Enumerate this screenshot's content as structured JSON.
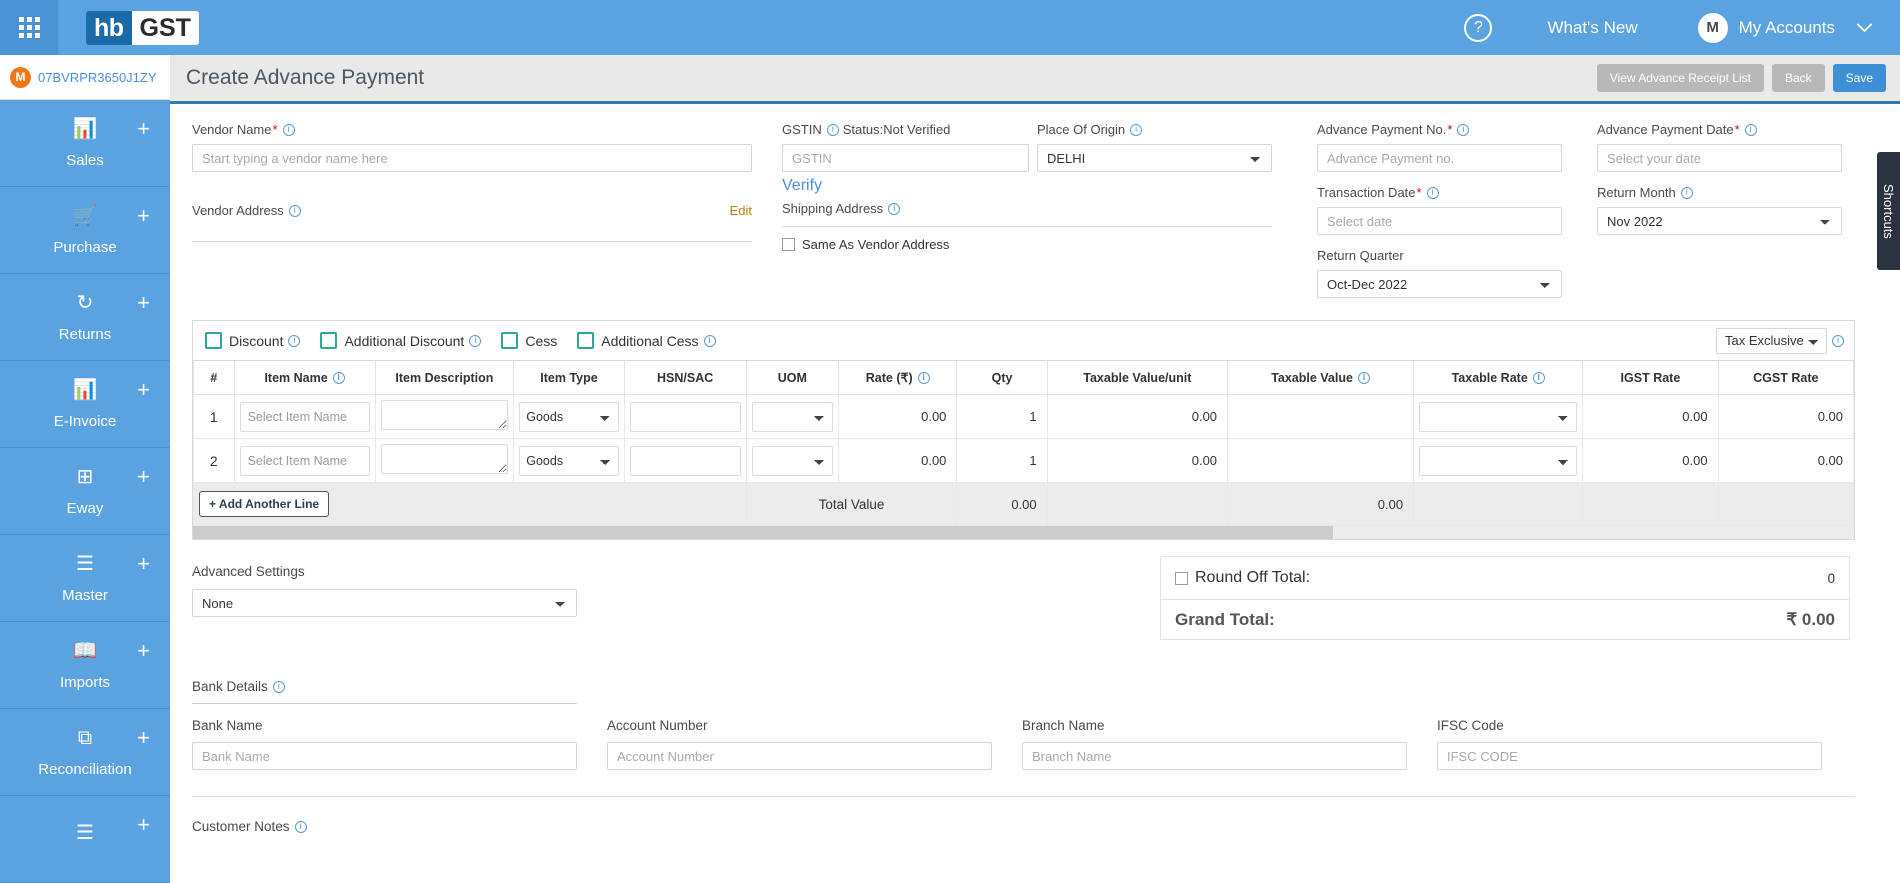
{
  "topbar": {
    "grid_icon": "apps-grid-icon",
    "logo_left": "hb",
    "logo_right": "GST",
    "help_icon": "?",
    "whats_new": "What's New",
    "avatar_initial": "M",
    "account_label": "My Accounts",
    "caret": "⌄"
  },
  "sidebar": {
    "gstin_badge": "M",
    "gstin": "07BVRPR3650J1ZY",
    "items": [
      {
        "label": "Sales",
        "icon": "bar-chart-icon",
        "glyph": "📊",
        "plus": "+"
      },
      {
        "label": "Purchase",
        "icon": "shopping-cart-icon",
        "glyph": "🛒",
        "plus": "+"
      },
      {
        "label": "Returns",
        "icon": "refresh-icon",
        "glyph": "↻",
        "plus": "+"
      },
      {
        "label": "E-Invoice",
        "icon": "bar-chart-icon",
        "glyph": "📊",
        "plus": "+"
      },
      {
        "label": "Eway",
        "icon": "grid-dashed-icon",
        "glyph": "⊞",
        "plus": "+"
      },
      {
        "label": "Master",
        "icon": "hamburger-icon",
        "glyph": "☰",
        "plus": "+"
      },
      {
        "label": "Imports",
        "icon": "bookmark-book-icon",
        "glyph": "📖",
        "plus": "+"
      },
      {
        "label": "Reconciliation",
        "icon": "layers-icon",
        "glyph": "⧉",
        "plus": "+"
      },
      {
        "label": "",
        "icon": "hamburger-icon",
        "glyph": "☰",
        "plus": "+"
      }
    ]
  },
  "page": {
    "title": "Create Advance Payment",
    "buttons": {
      "view_list": "View Advance Receipt List",
      "back": "Back",
      "save": "Save"
    },
    "shortcuts_tab": "Shortcuts"
  },
  "form": {
    "vendor_name_label": "Vendor Name",
    "vendor_name_placeholder": "Start typing a vendor name here",
    "vendor_address_label": "Vendor Address",
    "vendor_address_edit": "Edit",
    "gstin_label": "GSTIN",
    "gstin_status": "Status:Not Verified",
    "gstin_placeholder": "GSTIN",
    "verify_link": "Verify",
    "shipping_address_label": "Shipping Address",
    "same_as_vendor": "Same As Vendor Address",
    "place_of_origin_label": "Place Of Origin",
    "place_of_origin_value": "DELHI",
    "advance_payment_no_label": "Advance Payment No.",
    "advance_payment_no_placeholder": "Advance Payment no.",
    "advance_payment_date_label": "Advance Payment Date",
    "advance_payment_date_placeholder": "Select your date",
    "transaction_date_label": "Transaction Date",
    "transaction_date_placeholder": "Select date",
    "return_month_label": "Return Month",
    "return_month_value": "Nov 2022",
    "return_quarter_label": "Return Quarter",
    "return_quarter_value": "Oct-Dec 2022"
  },
  "toggles": [
    {
      "label": "Discount",
      "has_info": true
    },
    {
      "label": "Additional Discount",
      "has_info": true
    },
    {
      "label": "Cess",
      "has_info": false
    },
    {
      "label": "Additional Cess",
      "has_info": true
    }
  ],
  "tax_mode": "Tax Exclusive",
  "items_table": {
    "columns": [
      {
        "label": "#",
        "info": false
      },
      {
        "label": "Item Name",
        "info": true
      },
      {
        "label": "Item Description",
        "info": false
      },
      {
        "label": "Item Type",
        "info": false
      },
      {
        "label": "HSN/SAC",
        "info": false
      },
      {
        "label": "UOM",
        "info": false
      },
      {
        "label": "Rate (₹)",
        "info": true
      },
      {
        "label": "Qty",
        "info": false
      },
      {
        "label": "Taxable Value/unit",
        "info": false
      },
      {
        "label": "Taxable Value",
        "info": true
      },
      {
        "label": "Taxable Rate",
        "info": true
      },
      {
        "label": "IGST Rate",
        "info": false
      },
      {
        "label": "CGST Rate",
        "info": false
      }
    ],
    "item_name_placeholder": "Select Item Name",
    "rows": [
      {
        "num": "1",
        "item_name": "",
        "description": "",
        "item_type": "Goods",
        "hsn": "",
        "uom": "",
        "rate": "0.00",
        "qty": "1",
        "taxable_value_unit": "0.00",
        "taxable_value": "",
        "taxable_rate": "",
        "igst_rate": "0.00",
        "cgst_rate": "0.00"
      },
      {
        "num": "2",
        "item_name": "",
        "description": "",
        "item_type": "Goods",
        "hsn": "",
        "uom": "",
        "rate": "0.00",
        "qty": "1",
        "taxable_value_unit": "0.00",
        "taxable_value": "",
        "taxable_rate": "",
        "igst_rate": "0.00",
        "cgst_rate": "0.00"
      }
    ],
    "add_line_label": "+ Add Another Line",
    "total_label": "Total Value",
    "total_qty": "0.00",
    "total_taxable_value": "0.00"
  },
  "advanced": {
    "label": "Advanced Settings",
    "value": "None"
  },
  "totals": {
    "round_off_label": "Round Off Total:",
    "round_off_value": "0",
    "grand_total_label": "Grand Total:",
    "grand_total_value": "₹ 0.00"
  },
  "bank": {
    "section_label": "Bank Details",
    "fields": [
      {
        "label": "Bank Name",
        "placeholder": "Bank Name"
      },
      {
        "label": "Account Number",
        "placeholder": "Account Number"
      },
      {
        "label": "Branch Name",
        "placeholder": "Branch Name"
      },
      {
        "label": "IFSC Code",
        "placeholder": "IFSC CODE"
      }
    ]
  },
  "customer_notes_label": "Customer Notes"
}
